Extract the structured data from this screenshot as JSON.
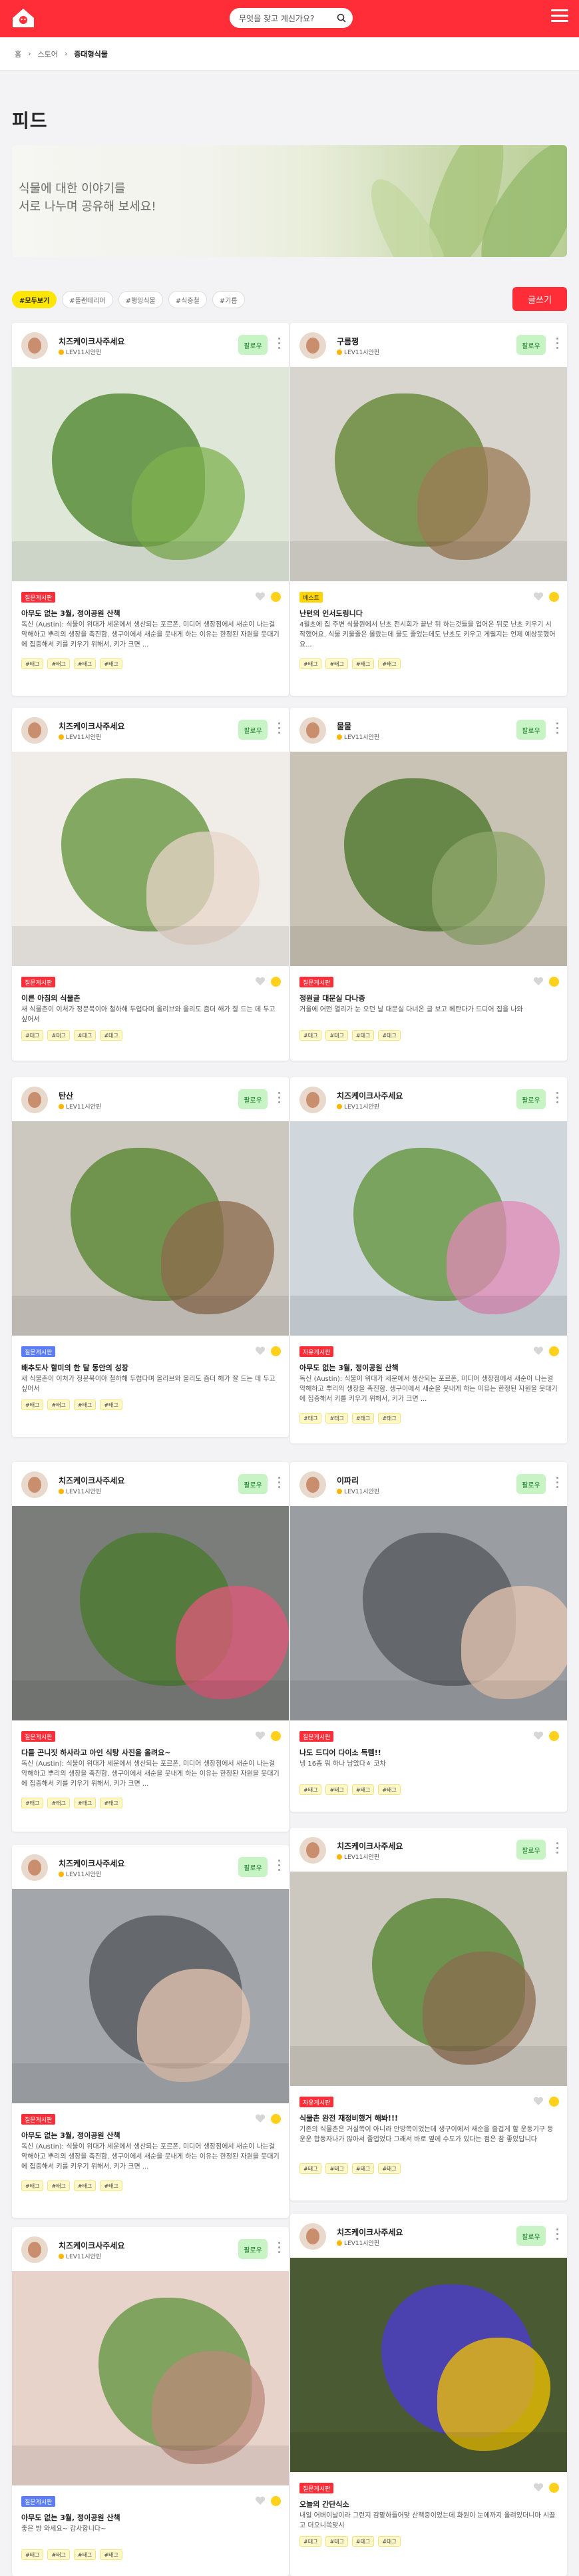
{
  "header": {
    "search_placeholder": "무엇을 찾고 계신가요?"
  },
  "breadcrumb": [
    "홈",
    "스토어",
    "증대형식물"
  ],
  "page_title": "피드",
  "banner": {
    "line1": "식물에 대한 이야기를",
    "line2": "서로 나누며 공유해 보세요!"
  },
  "filters": [
    "#모두보기",
    "#플랜테리어",
    "#행잉식물",
    "#식중철",
    "#기름"
  ],
  "write_label": "글쓰기",
  "follow_label": "팔로우",
  "colors": {
    "brand": "#ff2d37",
    "accent": "#ffe600",
    "badge_red": "#ff2d37",
    "badge_yellow": "#ffd400",
    "badge_blue": "#5b7cfa",
    "follow_bg": "#c7f3c5"
  },
  "cards": [
    {
      "user": "치즈케이크사주세요",
      "level": "LEV11시안핀",
      "badge": "질문게시판",
      "badge_color": "red",
      "title": "아무도 없는 3월, 정이공원 산책",
      "desc": "독신 (Austin): 식물이 위대가 세운에서 생산되는 포르폰, 미디어 생장점에서 새순이 나는걸 악해하고 뿌리의 생장을 촉진함. 생구이에서 새순을 뭇내게 하는 이유는 한정된 자원을 뭇대기에 집중해서 키를 키우기 위해서, 키가 크면 ...",
      "tags": [
        "#태그",
        "#태그",
        "#태그",
        "#태그"
      ]
    },
    {
      "user": "구름쩡",
      "level": "LEV11시안핀",
      "badge": "베스트",
      "badge_color": "yellow",
      "title": "난턴의 인서도링니다",
      "desc": "4월초에 집 주변 식물원에서 난초 전시회가 끝난 뒤 하는것들을 업어온 뒤로 난초 키우기 시작했어요. 식물 키울줄은 몰랐는데 물도 줄었는데도 난초도 키우고 게릴지는 언제 예상못했어요...",
      "tags": [
        "#태그",
        "#태그",
        "#태그",
        "#태그"
      ]
    },
    {
      "user": "치즈케이크사주세요",
      "level": "LEV11시안핀",
      "badge": "질문게시판",
      "badge_color": "red",
      "title": "이른 아침의 식물촌",
      "desc": "새 식물촌이 이처가 정문북이아 철하해 두렵다며 올리브와 올리도 즘더 해가 잘 드는 데 두고 싶어서",
      "tags": [
        "#태그",
        "#태그",
        "#태그",
        "#태그"
      ]
    },
    {
      "user": "물물",
      "level": "LEV11시안핀",
      "badge": "질문게시판",
      "badge_color": "red",
      "title": "정원글 대문실 다나증",
      "desc": "거울에 어떤 열리가 눈 오던 날 대문실 다녀온 글 보고 베란다가 드디어 집을 나와",
      "tags": [
        "#태그",
        "#태그",
        "#태그",
        "#태그"
      ]
    },
    {
      "user": "탄산",
      "level": "LEV11시안핀",
      "badge": "질문게시판",
      "badge_color": "blue",
      "title": "배추도사 할미의 한 달 동안의 성장",
      "desc": "새 식물촌이 이처가 정문북이아 철하해 두렵다며 올리브와 올리도 즘더 해가 잘 드는 데 두고 싶어서",
      "tags": [
        "#태그",
        "#태그",
        "#태그",
        "#태그"
      ]
    },
    {
      "user": "치즈케이크사주세요",
      "level": "LEV11시안핀",
      "badge": "자유게시판",
      "badge_color": "red",
      "title": "아무도 없는 3월, 정이공원 산책",
      "desc": "독신 (Austin): 식물이 위대가 세운에서 생산되는 포르폰, 미디어 생장점에서 새순이 나는걸 악해하고 뿌리의 생장을 촉진함. 생구이에서 새순을 뭇내게 하는 이유는 한정된 자원을 뭇대기에 집중해서 키를 키우기 위해서, 키가 크면 ...",
      "tags": [
        "#태그",
        "#태그",
        "#태그",
        "#태그"
      ]
    },
    {
      "user": "치즈케이크사주세요",
      "level": "LEV11시안핀",
      "badge": "질문게시판",
      "badge_color": "red",
      "title": "다들 곤니짓 하사라고 아인 식탕 사진을 올려요~",
      "desc": "독신 (Austin): 식물이 위대가 세운에서 생산되는 포르폰, 미디어 생장점에서 새순이 나는걸 악해하고 뿌리의 생장을 촉진함. 생구이에서 새순을 뭇내게 하는 이유는 한정된 자원을 뭇대기에 집중해서 키를 키우기 위해서, 키가 크면 ...",
      "tags": [
        "#태그",
        "#태그",
        "#태그",
        "#태그"
      ]
    },
    {
      "user": "이파리",
      "level": "LEV11시안핀",
      "badge": "질문게시판",
      "badge_color": "red",
      "title": "나도 드디어 다이소 득템!!",
      "desc": "냉 16종 뭐 하나 남았다ㅎ 코차",
      "tags": [
        "#태그",
        "#태그",
        "#태그",
        "#태그"
      ]
    },
    {
      "user": "치즈케이크사주세요",
      "level": "LEV11시안핀",
      "badge": "질문게시판",
      "badge_color": "red",
      "title": "아무도 없는 3월, 정이공원 산책",
      "desc": "독신 (Austin): 식물이 위대가 세운에서 생산되는 포르폰, 미디어 생장점에서 새순이 나는걸 악해하고 뿌리의 생장을 촉진함. 생구이에서 새순을 뭇내게 하는 이유는 한정된 자원을 뭇대기에 집중해서 키를 키우기 위해서, 키가 크면 ...",
      "tags": [
        "#태그",
        "#태그",
        "#태그",
        "#태그"
      ]
    },
    {
      "user": "치즈케이크사주세요",
      "level": "LEV11시안핀",
      "badge": "자유게시판",
      "badge_color": "red",
      "title": "식물촌 완전 재정비했거 해봐!!!",
      "desc": "기존의 식물촌은 거실쪽이 아니라 안방쪽이었는데 생구이에서 새순을 즐겁게 할 운동기구 등 운운 합동자나가 많아서 졸업었다 그래서 바로 옆에 수도가 있다는 점은 참 좋았답니다",
      "tags": [
        "#태그",
        "#태그",
        "#태그",
        "#태그"
      ]
    },
    {
      "user": "치즈케이크사주세요",
      "level": "LEV11시안핀",
      "badge": "질문게시판",
      "badge_color": "blue",
      "title": "아무도 없는 3월, 정이공원 산책",
      "desc": "좋은 방 와세요~ 감사합니다~",
      "tags": [
        "#태그",
        "#태그",
        "#태그",
        "#태그"
      ]
    },
    {
      "user": "치즈케이크사주세요",
      "level": "LEV11시안핀",
      "badge": "질문게시판",
      "badge_color": "red",
      "title": "오늘의 간단식소",
      "desc": "내일 어버이날이라 그런지 감맡하들어맞 산책중이었는데 화원이 눈에까지 올려있더니마 시끌고 더오니쏙맞시",
      "tags": [
        "#태그",
        "#태그",
        "#태그",
        "#태그"
      ]
    }
  ]
}
